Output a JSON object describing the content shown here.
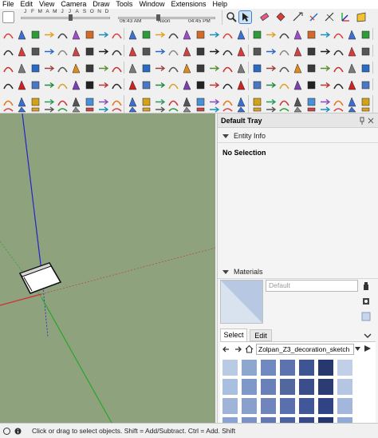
{
  "menubar": {
    "items": [
      "File",
      "Edit",
      "View",
      "Camera",
      "Draw",
      "Tools",
      "Window",
      "Extensions",
      "Help"
    ]
  },
  "shadow": {
    "months": [
      "J",
      "F",
      "M",
      "A",
      "M",
      "J",
      "J",
      "A",
      "S",
      "O",
      "N",
      "D"
    ],
    "time_start": "06:43 AM",
    "time_mid": "Noon",
    "time_end": "04:45 PM"
  },
  "toolbar_icons": {
    "row1_right": [
      "zoom-icon",
      "select-arrow-icon",
      "paint-bucket-icon",
      "eraser-icon",
      "tape-measure-icon",
      "dimension-icon",
      "protractor-icon",
      "axes-icon",
      "section-plane-icon"
    ],
    "badge_50": "50",
    "badge_75": "75"
  },
  "tray": {
    "title": "Default Tray",
    "entity_info_label": "Entity Info",
    "no_selection": "No Selection",
    "materials_label": "Materials",
    "material_name_placeholder": "Default",
    "tab_select": "Select",
    "tab_edit": "Edit",
    "collection": "Zolpan_Z3_decoration_sketch",
    "swatch_colors": [
      [
        "#b8cbe3",
        "#8ea7cf",
        "#7089c1",
        "#5d73b0",
        "#3f5493",
        "#26386e",
        "#c1d0e8"
      ],
      [
        "#a9bfe0",
        "#7e98c9",
        "#6a80b8",
        "#53679f",
        "#3b4d8a",
        "#2b3b74",
        "#b5c6e2"
      ],
      [
        "#9fb4d8",
        "#8aa0cc",
        "#6f85bc",
        "#5a70ae",
        "#41579a",
        "#2f4385",
        "#a3b7dc"
      ],
      [
        "#8ba4d3",
        "#7a92c6",
        "#6379b4",
        "#4d62a1",
        "#37498b",
        "#25356f",
        "#91a9d6"
      ]
    ]
  },
  "status": {
    "text": "Click or drag to select objects. Shift = Add/Subtract. Ctrl = Add. Shift"
  }
}
